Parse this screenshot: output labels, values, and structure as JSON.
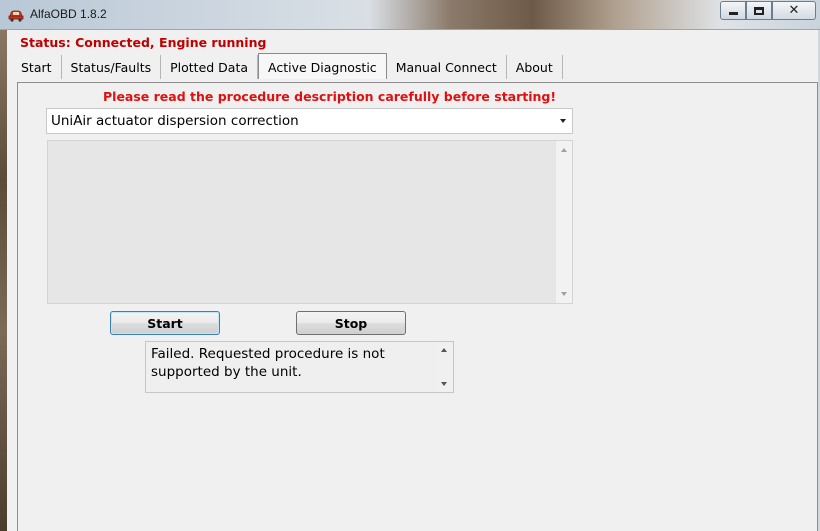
{
  "window": {
    "title": "AlfaOBD 1.8.2",
    "icon": "car-icon"
  },
  "status": {
    "text": "Status: Connected, Engine running",
    "color": "#c00000"
  },
  "tabs": [
    {
      "label": "Start",
      "active": false
    },
    {
      "label": "Status/Faults",
      "active": false
    },
    {
      "label": "Plotted Data",
      "active": false
    },
    {
      "label": "Active Diagnostic",
      "active": true
    },
    {
      "label": "Manual Connect",
      "active": false
    },
    {
      "label": "About",
      "active": false
    }
  ],
  "main": {
    "warning": "Please read the procedure description carefully before starting!",
    "warning_color": "#e01010",
    "procedure_select": {
      "selected": "UniAir actuator dispersion correction"
    },
    "description": "",
    "start_label": "Start",
    "stop_label": "Stop",
    "result_text": "Failed. Requested procedure is not supported by the unit."
  }
}
